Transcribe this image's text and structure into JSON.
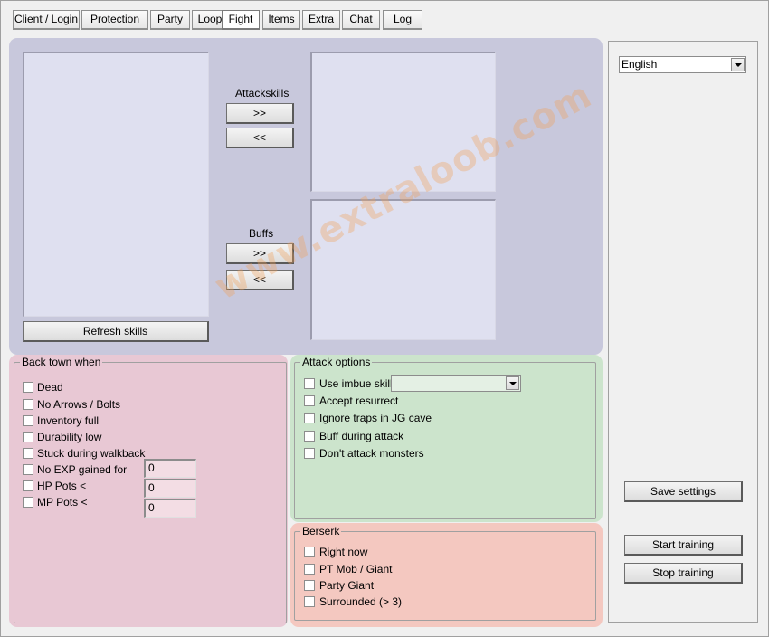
{
  "tabs": [
    "Client / Login",
    "Protection",
    "Party",
    "Loop",
    "Fight",
    "Items",
    "Extra",
    "Chat",
    "Log"
  ],
  "active_tab": "Fight",
  "skills": {
    "refresh_label": "Refresh skills",
    "attack_label": "Attackskills",
    "buffs_label": "Buffs",
    "add_label": ">>",
    "remove_label": "<<"
  },
  "back_town": {
    "title": "Back town when",
    "items": [
      "Dead",
      "No Arrows / Bolts",
      "Inventory full",
      "Durability low",
      "Stuck during walkback",
      "No EXP gained for",
      "HP Pots <",
      "MP Pots <"
    ],
    "exp_value": "0",
    "hp_value": "0",
    "mp_value": "0"
  },
  "attack_options": {
    "title": "Attack options",
    "items": [
      "Use imbue skill",
      "Accept resurrect",
      "Ignore traps in JG cave",
      "Buff during attack",
      "Don't attack monsters"
    ]
  },
  "berserk": {
    "title": "Berserk",
    "items": [
      "Right now",
      "PT Mob / Giant",
      "Party Giant",
      "Surrounded (> 3)"
    ]
  },
  "side": {
    "language": "English",
    "save_label": "Save settings",
    "start_label": "Start training",
    "stop_label": "Stop training"
  },
  "watermark": "www.extraloob.com",
  "colors": {
    "skills_panel": "#c8c8dc",
    "backtown_panel": "#e8c8d4",
    "attack_panel": "#cce4cc",
    "berserk_panel": "#f4c8c0"
  }
}
